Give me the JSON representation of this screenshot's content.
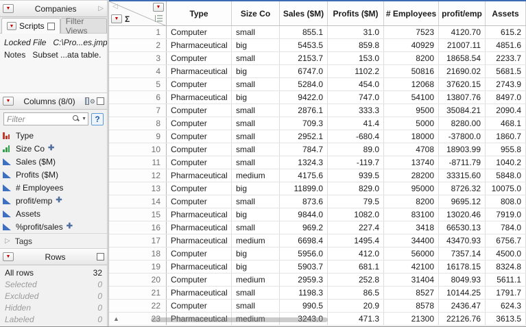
{
  "icons": {
    "red_triangle": "▼",
    "disclosure": "▷",
    "collapse": "◁",
    "sum": "Σ",
    "scroll_up": "▲",
    "help": "?",
    "caret": "▼"
  },
  "colors": {
    "accent_blue": "#3c69b4",
    "red_triangle": "#c40000",
    "continuous_icon": "#3f6fbf"
  },
  "sidebar": {
    "companies": {
      "title": "Companies"
    },
    "tabs": [
      "Scripts",
      "Filter Views"
    ],
    "scripts": [
      {
        "name": "Locked File",
        "value": "C:\\Pro...es.jmp",
        "italic": true
      },
      {
        "name": "Notes",
        "value": "Subset ...ata table.",
        "italic": false
      }
    ],
    "columns": {
      "title": "Columns (8/0)",
      "filter_placeholder": "Filter",
      "items": [
        {
          "label": "Type",
          "icon": "nominal",
          "formula": false
        },
        {
          "label": "Size Co",
          "icon": "ordinal",
          "formula": true
        },
        {
          "label": "Sales ($M)",
          "icon": "continuous",
          "formula": false
        },
        {
          "label": "Profits ($M)",
          "icon": "continuous",
          "formula": false
        },
        {
          "label": "# Employees",
          "icon": "continuous",
          "formula": false
        },
        {
          "label": "profit/emp",
          "icon": "continuous",
          "formula": true
        },
        {
          "label": "Assets",
          "icon": "continuous",
          "formula": false
        },
        {
          "label": "%profit/sales",
          "icon": "continuous",
          "formula": true
        }
      ],
      "tags_label": "Tags"
    },
    "rows": {
      "title": "Rows",
      "stats": [
        {
          "label": "All rows",
          "value": "32",
          "muted": false
        },
        {
          "label": "Selected",
          "value": "0",
          "muted": true
        },
        {
          "label": "Excluded",
          "value": "0",
          "muted": true
        },
        {
          "label": "Hidden",
          "value": "0",
          "muted": true
        },
        {
          "label": "Labeled",
          "value": "0",
          "muted": true
        }
      ]
    }
  },
  "table": {
    "columns": [
      "Type",
      "Size Co",
      "Sales ($M)",
      "Profits ($M)",
      "# Employees",
      "profit/emp",
      "Assets"
    ],
    "rows": [
      [
        "1",
        "Computer",
        "small",
        "855.1",
        "31.0",
        "7523",
        "4120.70",
        "615.2"
      ],
      [
        "2",
        "Pharmaceutical",
        "big",
        "5453.5",
        "859.8",
        "40929",
        "21007.11",
        "4851.6"
      ],
      [
        "3",
        "Computer",
        "small",
        "2153.7",
        "153.0",
        "8200",
        "18658.54",
        "2233.7"
      ],
      [
        "4",
        "Pharmaceutical",
        "big",
        "6747.0",
        "1102.2",
        "50816",
        "21690.02",
        "5681.5"
      ],
      [
        "5",
        "Computer",
        "small",
        "5284.0",
        "454.0",
        "12068",
        "37620.15",
        "2743.9"
      ],
      [
        "6",
        "Pharmaceutical",
        "big",
        "9422.0",
        "747.0",
        "54100",
        "13807.76",
        "8497.0"
      ],
      [
        "7",
        "Computer",
        "small",
        "2876.1",
        "333.3",
        "9500",
        "35084.21",
        "2090.4"
      ],
      [
        "8",
        "Computer",
        "small",
        "709.3",
        "41.4",
        "5000",
        "8280.00",
        "468.1"
      ],
      [
        "9",
        "Computer",
        "small",
        "2952.1",
        "-680.4",
        "18000",
        "-37800.0",
        "1860.7"
      ],
      [
        "10",
        "Computer",
        "small",
        "784.7",
        "89.0",
        "4708",
        "18903.99",
        "955.8"
      ],
      [
        "11",
        "Computer",
        "small",
        "1324.3",
        "-119.7",
        "13740",
        "-8711.79",
        "1040.2"
      ],
      [
        "12",
        "Pharmaceutical",
        "medium",
        "4175.6",
        "939.5",
        "28200",
        "33315.60",
        "5848.0"
      ],
      [
        "13",
        "Computer",
        "big",
        "11899.0",
        "829.0",
        "95000",
        "8726.32",
        "10075.0"
      ],
      [
        "14",
        "Computer",
        "small",
        "873.6",
        "79.5",
        "8200",
        "9695.12",
        "808.0"
      ],
      [
        "15",
        "Pharmaceutical",
        "big",
        "9844.0",
        "1082.0",
        "83100",
        "13020.46",
        "7919.0"
      ],
      [
        "16",
        "Pharmaceutical",
        "small",
        "969.2",
        "227.4",
        "3418",
        "66530.13",
        "784.0"
      ],
      [
        "17",
        "Pharmaceutical",
        "medium",
        "6698.4",
        "1495.4",
        "34400",
        "43470.93",
        "6756.7"
      ],
      [
        "18",
        "Computer",
        "big",
        "5956.0",
        "412.0",
        "56000",
        "7357.14",
        "4500.0"
      ],
      [
        "19",
        "Pharmaceutical",
        "big",
        "5903.7",
        "681.1",
        "42100",
        "16178.15",
        "8324.8"
      ],
      [
        "20",
        "Computer",
        "medium",
        "2959.3",
        "252.8",
        "31404",
        "8049.93",
        "5611.1"
      ],
      [
        "21",
        "Pharmaceutical",
        "small",
        "1198.3",
        "86.5",
        "8527",
        "10144.25",
        "1791.7"
      ],
      [
        "22",
        "Computer",
        "small",
        "990.5",
        "20.9",
        "8578",
        "2436.47",
        "624.3"
      ],
      [
        "23",
        "Pharmaceutical",
        "medium",
        "3243.0",
        "471.3",
        "21300",
        "22126.76",
        "3613.5"
      ]
    ]
  }
}
